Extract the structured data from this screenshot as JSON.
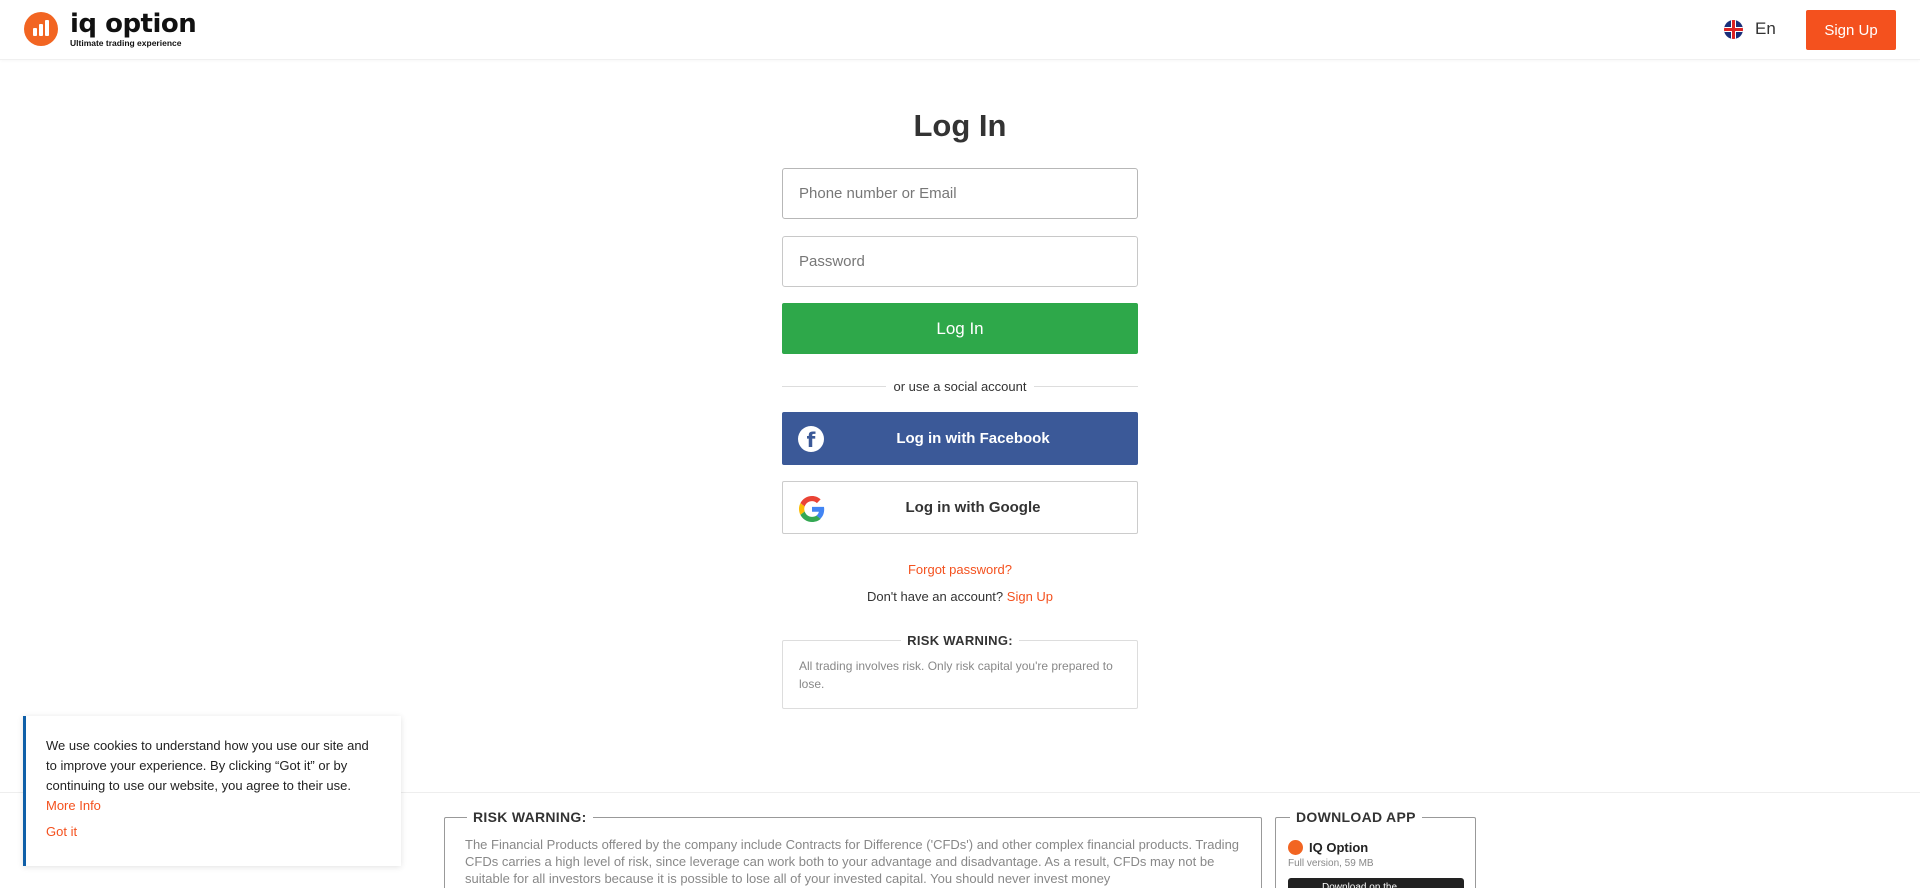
{
  "header": {
    "logo_name": "iq option",
    "logo_tagline": "Ultimate trading experience",
    "language": "En",
    "signup_label": "Sign Up"
  },
  "login": {
    "title": "Log In",
    "identity_placeholder": "Phone number or Email",
    "password_placeholder": "Password",
    "submit_label": "Log In",
    "divider_text": "or use a social account",
    "facebook_label": "Log in with Facebook",
    "google_label": "Log in with Google",
    "forgot_label": "Forgot password?",
    "no_account_text": "Don't have an account?",
    "no_account_link": "Sign Up",
    "risk_title": "RISK WARNING:",
    "risk_text": "All trading involves risk. Only risk capital you're prepared to lose."
  },
  "footer": {
    "risk_title": "RISK WARNING:",
    "risk_text": "The Financial Products offered by the company include Contracts for Difference ('CFDs') and other complex financial products. Trading CFDs carries a high level of risk, since leverage can work both to your advantage and disadvantage. As a result, CFDs may not be suitable for all investors because it is possible to lose all of your invested capital. You should never invest money",
    "download_title": "DOWNLOAD APP",
    "app_name": "IQ Option",
    "app_size": "Full version, 59 MB",
    "download_button": "Download on the"
  },
  "cookie": {
    "text": "We use cookies to understand how you use our site and to improve your experience. By clicking “Got it” or by continuing to use our website, you agree to their use.",
    "more_info": "More Info",
    "got_it": "Got it"
  },
  "colors": {
    "brand_orange": "#f4511e",
    "login_green": "#2ea84a",
    "facebook_blue": "#3b5998",
    "cookie_accent": "#0f5fa8"
  }
}
